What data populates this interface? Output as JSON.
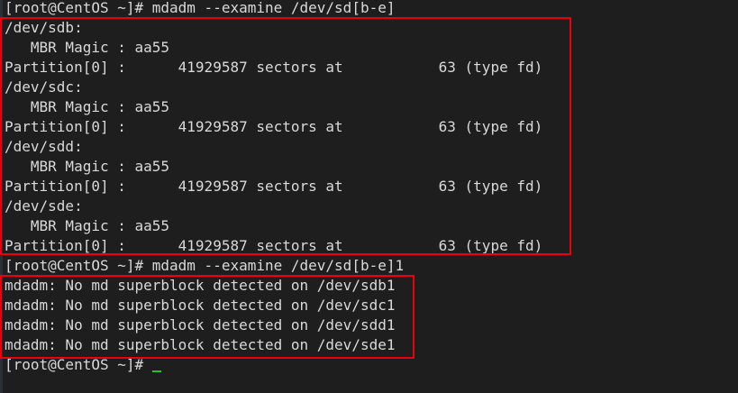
{
  "terminal": {
    "lines": [
      "[root@CentOS ~]# mdadm --examine /dev/sd[b-e]",
      "/dev/sdb:",
      "   MBR Magic : aa55",
      "Partition[0] :      41929587 sectors at           63 (type fd)",
      "/dev/sdc:",
      "   MBR Magic : aa55",
      "Partition[0] :      41929587 sectors at           63 (type fd)",
      "/dev/sdd:",
      "   MBR Magic : aa55",
      "Partition[0] :      41929587 sectors at           63 (type fd)",
      "/dev/sde:",
      "   MBR Magic : aa55",
      "Partition[0] :      41929587 sectors at           63 (type fd)",
      "[root@CentOS ~]# mdadm --examine /dev/sd[b-e]1",
      "mdadm: No md superblock detected on /dev/sdb1",
      "mdadm: No md superblock detected on /dev/sdc1",
      "mdadm: No md superblock detected on /dev/sdd1",
      "mdadm: No md superblock detected on /dev/sde1"
    ],
    "prompt": "[root@CentOS ~]# "
  },
  "colors": {
    "background": "#1e1e1e",
    "text": "#d9d9d9",
    "highlight_box": "#e8000b",
    "cursor": "#22c22c"
  }
}
